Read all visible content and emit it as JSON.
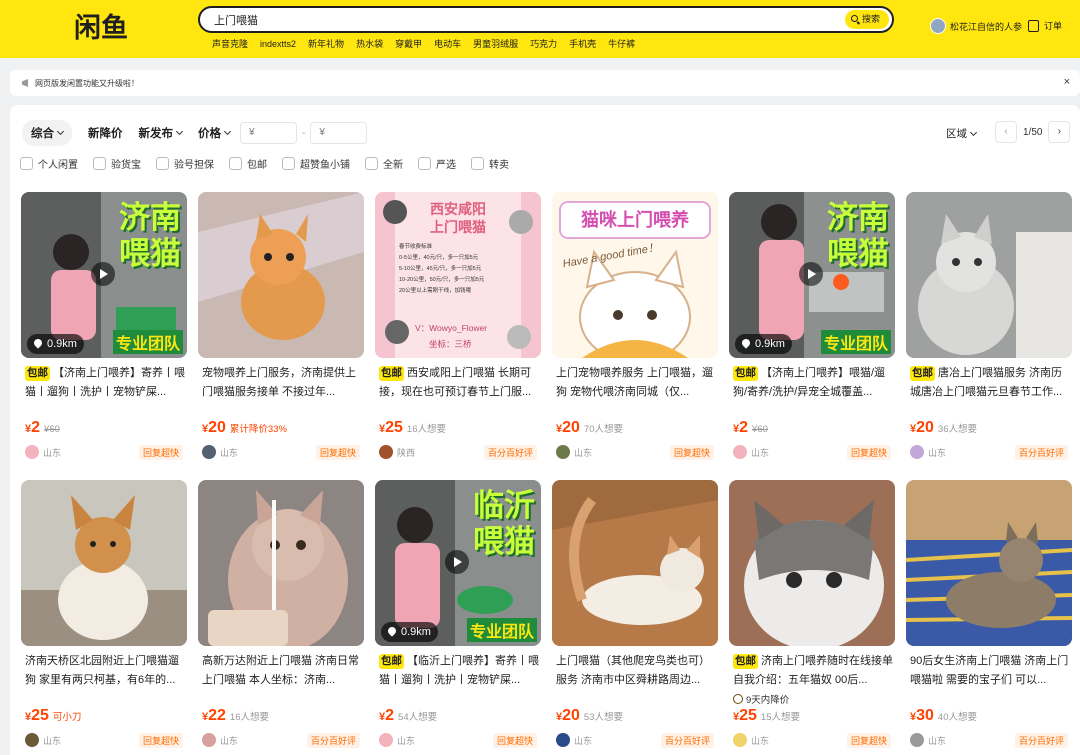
{
  "app": {
    "logo_text": "闲鱼"
  },
  "search": {
    "value": "上门喂猫",
    "button": "搜索"
  },
  "hotwords": [
    "声音克隆",
    "indextts2",
    "新年礼物",
    "热水袋",
    "穿戴甲",
    "电动车",
    "男童羽绒服",
    "巧克力",
    "手机壳",
    "牛仔裤"
  ],
  "user": {
    "name": "松花江自信的人参",
    "orders_label": "订单"
  },
  "notice": {
    "text": "网页版发闲置功能又升级啦！",
    "close": "×"
  },
  "sort": {
    "items": [
      "综合",
      "新降价",
      "新发布",
      "价格"
    ],
    "price_min_placeholder": "¥",
    "price_max_placeholder": "¥",
    "price_dash": "-",
    "region": "区域",
    "page": "1/50",
    "prev": "‹",
    "next": "›"
  },
  "filters": [
    "个人闲置",
    "验货宝",
    "验号担保",
    "包邮",
    "超赞鱼小铺",
    "全新",
    "严选",
    "转卖"
  ],
  "colors": {
    "brand": "#ffe60f",
    "price": "#ff4400",
    "badge_text": "#ff6a00",
    "badge_bg": "#fff1e5"
  },
  "products": [
    {
      "baoyou": "包邮",
      "title": "【济南上门喂养】寄养丨喂猫丨遛狗丨洗护丨宠物铲屎...",
      "price": "2",
      "note": "¥60",
      "note_style": "strike",
      "location": "山东",
      "badge": "回复超快",
      "distance": "0.9km",
      "overlay_title": "济南\n喂猫",
      "overlay_footer": "专业团队"
    },
    {
      "baoyou": "",
      "title": "宠物喂养上门服务，济南提供上门喂猫服务接单 不接过年...",
      "price": "20",
      "note": "累计降价33%",
      "note_style": "red",
      "location": "山东",
      "badge": "回复超快"
    },
    {
      "baoyou": "包邮",
      "title": "西安咸阳上门喂猫 长期可接，现在也可预订春节上门服...",
      "price": "25",
      "note": "16人想要",
      "note_style": "",
      "location": "陕西",
      "badge": "百分百好评",
      "overlay_title": "西安咸阳\n上门喂猫",
      "overlay_lines": [
        "春节收费标准",
        "0-5公里，40元/只，多一只加5元",
        "5-10公里，45元/只，多一只加5元",
        "10-20公里，50元/只，多一只加5元",
        "20公里以上需刚干线，加钱哦",
        "V：Wowyo_Flower",
        "坐标：三桥"
      ]
    },
    {
      "baoyou": "",
      "title": "上门宠物喂养服务 上门喂猫，遛狗 宠物代喂济南同城（仅...",
      "price": "20",
      "note": "70人想要",
      "note_style": "",
      "location": "山东",
      "badge": "回复超快",
      "overlay_title": "猫咪上门喂养",
      "overlay_sub": "Have a good time！"
    },
    {
      "baoyou": "包邮",
      "title": "【济南上门喂养】喂猫/遛狗/寄养/洗护/异宠全城覆盖...",
      "price": "2",
      "note": "¥60",
      "note_style": "strike",
      "location": "山东",
      "badge": "回复超快",
      "distance": "0.9km",
      "overlay_title": "济南\n喂猫",
      "overlay_footer": "专业团队"
    },
    {
      "baoyou": "包邮",
      "title": "唐冶上门喂猫服务 济南历城唐冶上门喂猫元旦春节工作...",
      "price": "20",
      "note": "36人想要",
      "note_style": "",
      "location": "山东",
      "badge": "百分百好评"
    },
    {
      "baoyou": "",
      "title": "济南天桥区北园附近上门喂猫遛狗 家里有两只柯基，有6年的...",
      "price": "25",
      "note": "可小刀",
      "note_style": "red",
      "location": "山东",
      "badge": "回复超快"
    },
    {
      "baoyou": "",
      "title": "高新万达附近上门喂猫 济南日常上门喂猫 本人坐标：济南...",
      "price": "22",
      "note": "16人想要",
      "note_style": "",
      "location": "山东",
      "badge": "百分百好评"
    },
    {
      "baoyou": "包邮",
      "title": "【临沂上门喂养】寄养丨喂猫丨遛狗丨洗护丨宠物铲屎...",
      "price": "2",
      "note": "54人想要",
      "note_style": "",
      "location": "山东",
      "badge": "回复超快",
      "distance": "0.9km",
      "overlay_title": "临沂\n喂猫",
      "overlay_footer": "专业团队"
    },
    {
      "baoyou": "",
      "title": "上门喂猫（其他爬宠鸟类也可）服务 济南市中区舜耕路周边...",
      "price": "20",
      "note": "53人想要",
      "note_style": "",
      "location": "山东",
      "badge": "百分百好评"
    },
    {
      "baoyou": "包邮",
      "title": "济南上门喂养随时在线接单 自我介绍：五年猫奴 00后...",
      "price": "25",
      "note": "15人想要",
      "note_style": "",
      "location": "山东",
      "badge": "回复超快",
      "subtag": "9天内降价"
    },
    {
      "baoyou": "",
      "title": "90后女生济南上门喂猫 济南上门喂猫啦 需要的宝子们 可以...",
      "price": "30",
      "note": "40人想要",
      "note_style": "",
      "location": "山东",
      "badge": "百分百好评"
    }
  ]
}
